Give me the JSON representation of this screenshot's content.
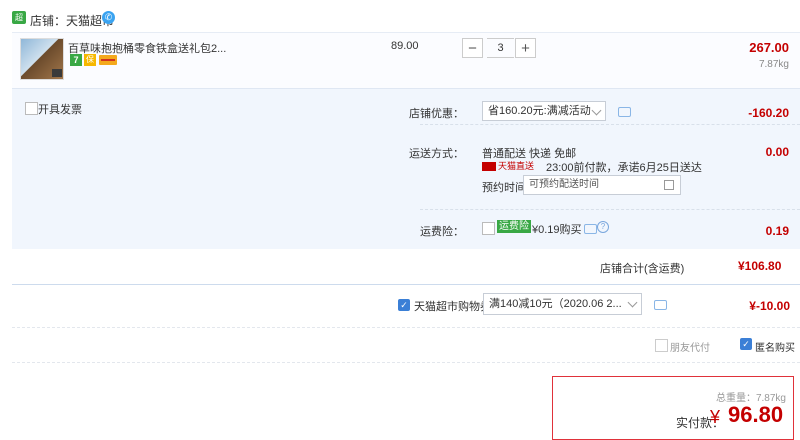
{
  "shop": {
    "label": "店铺：天猫超市",
    "logo_text": "超市"
  },
  "item": {
    "title": "百草味抱抱桶零食铁盒送礼包2...",
    "unit_price": "89.00",
    "quantity": "3",
    "subtotal": "267.00",
    "weight": "7.87kg",
    "service_badges": [
      "7",
      "保"
    ],
    "minus": "−",
    "plus": "+"
  },
  "invoice": {
    "label": "开具发票"
  },
  "shop_discount": {
    "label": "店铺优惠：",
    "selected": "省160.20元:满减活动",
    "amount": "-160.20"
  },
  "shipping": {
    "label": "运送方式：",
    "method": "普通配送 快递 免邮",
    "tag": "天猫直送",
    "time_note": "23:00前付款，承诺6月25日送达",
    "appointment_label": "预约时间",
    "appointment_placeholder": "可预约配送时间",
    "amount": "0.00"
  },
  "insurance": {
    "label": "运费险：",
    "badge": "运费险",
    "text": "¥0.19购买",
    "help": "?",
    "amount": "0.19"
  },
  "shop_total": {
    "label": "店铺合计(含运费)",
    "amount": "¥106.80"
  },
  "coupon": {
    "label": "天猫超市购物券",
    "selected": "满140减10元（2020.06 2...",
    "amount": "¥-10.00",
    "checked": true
  },
  "options": {
    "friend_pay": "朋友代付",
    "anonymous": "匿名购买"
  },
  "payment": {
    "weight_label": "总重量：7.87kg",
    "label": "实付款：",
    "currency": "¥",
    "amount": "96.80"
  },
  "colors": {
    "accent_red": "#c40000",
    "check_blue": "#3b7fd6",
    "green": "#39a845"
  }
}
